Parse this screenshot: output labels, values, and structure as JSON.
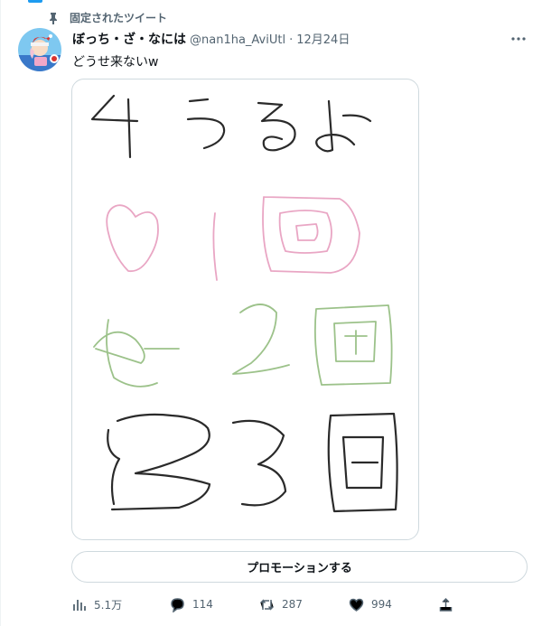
{
  "pinned_label": "固定されたツイート",
  "author": {
    "name": "ぼっち・ざ・なには",
    "handle": "@nan1ha_AviUtl",
    "separator": "·",
    "date": "12月24日"
  },
  "tweet_text": "どうせ来ないw",
  "promote_label": "プロモーションする",
  "stats": {
    "views": "5.1万",
    "replies": "114",
    "retweets": "287",
    "likes": "994"
  },
  "colors": {
    "accent": "#1d9bf0",
    "secondary_text": "#536471",
    "ink_black": "#2a2a2a",
    "ink_pink": "#e9a6c4",
    "ink_green": "#9cc28a"
  },
  "icons": {
    "pin": "pin-icon",
    "more": "more-icon",
    "views": "analytics-icon",
    "reply": "reply-icon",
    "retweet": "retweet-icon",
    "like": "heart-icon",
    "share": "share-icon"
  }
}
